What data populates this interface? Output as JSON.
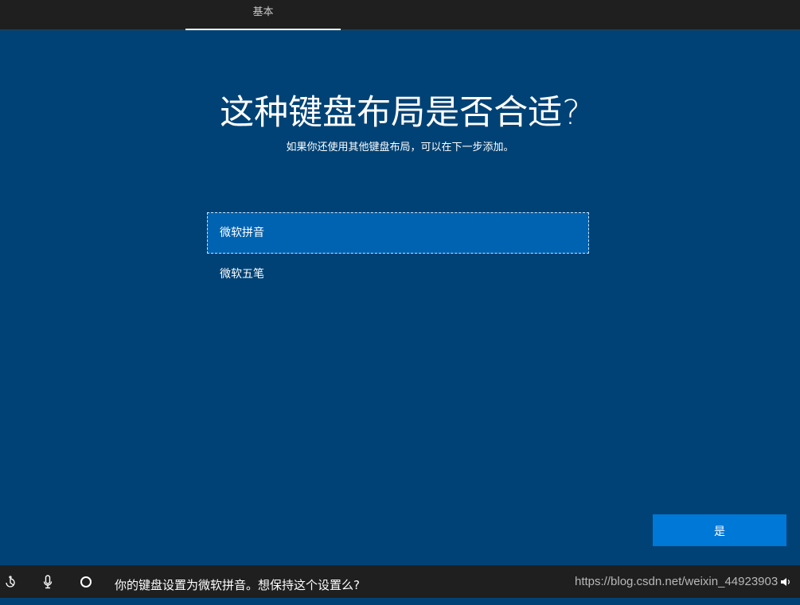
{
  "header": {
    "tab_label": "基本"
  },
  "main": {
    "title": "这种键盘布局是否合适?",
    "subtitle": "如果你还使用其他键盘布局，可以在下一步添加。",
    "options": [
      {
        "label": "微软拼音",
        "selected": true
      },
      {
        "label": "微软五笔",
        "selected": false
      }
    ],
    "yes_label": "是"
  },
  "footer": {
    "icons": [
      "accessibility-icon",
      "microphone-icon",
      "cortana-icon",
      "volume-icon"
    ],
    "cortana_text": "你的键盘设置为微软拼音。想保持这个设置么?",
    "watermark": "https://blog.csdn.net/weixin_44923903"
  },
  "colors": {
    "background": "#004275",
    "topbar": "#1f1f1f",
    "selected_option": "#0063b1",
    "button": "#0078d7"
  }
}
